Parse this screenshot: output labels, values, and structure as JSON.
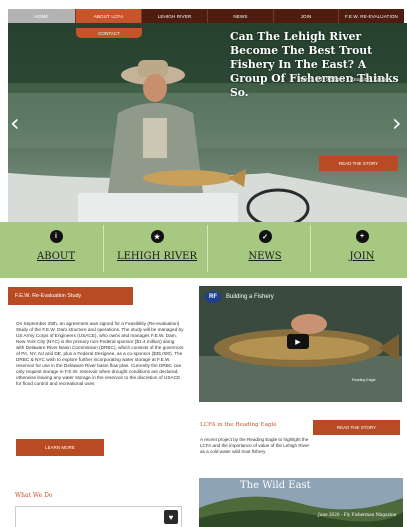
{
  "nav": {
    "items": [
      "HOME",
      "ABOUT LCFA",
      "LEHIGH RIVER",
      "NEWS",
      "JOIN",
      "F.E.W. RE-EVALUATION"
    ],
    "contact": "CONTACT"
  },
  "hero": {
    "title": "Can The Lehigh River Become The Best Trout Fishery In The East? A Group Of Fishermen Thinks So.",
    "subtitle": "March 2019 Story - Reading Eagle",
    "button": "READ THE STORY",
    "prev_icon": "chevron-left-icon",
    "next_icon": "chevron-right-icon"
  },
  "band": {
    "items": [
      {
        "label": "ABOUT",
        "icon": "info-icon",
        "glyph": "i"
      },
      {
        "label": "LEHIGH RIVER",
        "icon": "star-icon",
        "glyph": "★"
      },
      {
        "label": "NEWS",
        "icon": "check-icon",
        "glyph": "✓"
      },
      {
        "label": "JOIN",
        "icon": "plus-icon",
        "glyph": "+"
      }
    ]
  },
  "few": {
    "heading": "F.E.W. Re-Evaluation Study",
    "body": "On September 25th, an agreement was signed for a Feasibility (Re-evaluation) Study of the F.E.W. Dam structure and operations. The study will be managed by US Army Corps of Engineers (USACE), who owns and manages F.E.W. Dam. New York City (NYC) is the primary non-Federal sponsor ($1.4 million) along with Delaware River Basin Commission (DRBC), which consists of the governors of PA, NY, NJ and DE, plus a Federal Designee, as a co-sponsor ($35,000). The DRBC & NYC wish to explore further incorporating water storage at F.E.W. reservoir for use in the Delaware River basin flow plan. Currently the DRBC can only request storage in F.E.W. reservoir when drought conditions are declared, otherwise leaving any water storage in the reservoir to the discretion of USACE for flood control and recreational uses",
    "button": "LEARN MORE"
  },
  "what": {
    "heading": "What We Do",
    "card_text": "",
    "heart_icon": "heart-icon"
  },
  "video": {
    "logo": "RF",
    "title": "Building a Fishery",
    "brand": "Reading Eagle",
    "play_icon": "play-icon"
  },
  "lcfa": {
    "heading": "LCFA in the Reading Eagle",
    "button": "READ THE STORY",
    "body": "A recent project by the Reading Eagle to highlight the LCFA and the importance of value of the Lehigh River as a cold water wild trout fishery"
  },
  "wild": {
    "title": "The Wild East",
    "subtitle": "June 2020 - Fly Fisherman Magazine"
  },
  "colors": {
    "nav_bg": "#4e1d10",
    "accent": "#b84b24",
    "band_green": "#a7c880"
  }
}
